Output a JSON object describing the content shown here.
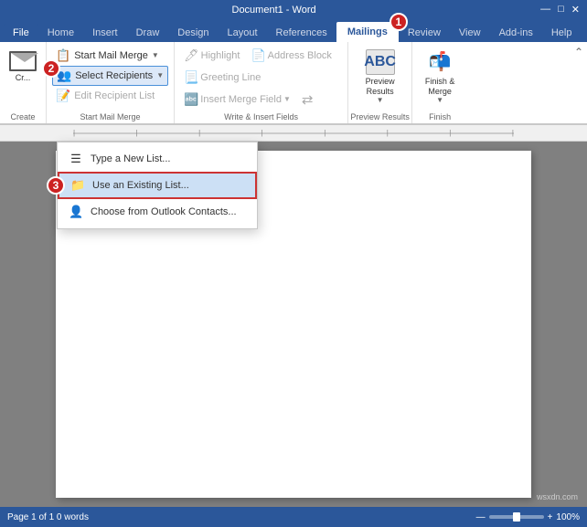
{
  "titleBar": {
    "text": "Document1 - Word"
  },
  "ribbonTabs": {
    "tabs": [
      {
        "label": "File",
        "active": false
      },
      {
        "label": "Home",
        "active": false
      },
      {
        "label": "Insert",
        "active": false
      },
      {
        "label": "Draw",
        "active": false
      },
      {
        "label": "Design",
        "active": false
      },
      {
        "label": "Layout",
        "active": false
      },
      {
        "label": "References",
        "active": false
      },
      {
        "label": "Mailings",
        "active": true
      },
      {
        "label": "Review",
        "active": false
      },
      {
        "label": "View",
        "active": false
      },
      {
        "label": "Add-ins",
        "active": false
      },
      {
        "label": "Help",
        "active": false
      }
    ]
  },
  "ribbon": {
    "groups": {
      "create": {
        "label": "Create",
        "buttons": [
          {
            "label": "Cr..."
          }
        ]
      },
      "startMailMerge": {
        "label": "Start Mail Merge",
        "startBtn": "Start Mail Merge",
        "selectRecipientsBtn": "Select Recipients",
        "editRecipientsBtn": "Edit Recipient List"
      },
      "writeInsertFields": {
        "label": "Write & Insert Fields",
        "highlightBtn": "Highlight",
        "addressBlockBtn": "Address Block",
        "greetingLineBtn": "Greeting Line",
        "insertMergeFieldBtn": "Insert Merge Field",
        "matchFieldsBtn": "Match Fields"
      },
      "previewResults": {
        "label": "Preview Results",
        "btn": "Preview\nResults"
      },
      "finish": {
        "label": "Finish",
        "btn": "Finish &\nMerge"
      }
    }
  },
  "dropdownMenu": {
    "items": [
      {
        "icon": "☰",
        "label": "Type a New List...",
        "highlighted": false
      },
      {
        "icon": "📁",
        "label": "Use an Existing List...",
        "highlighted": true
      },
      {
        "icon": "👤",
        "label": "Choose from Outlook Contacts...",
        "highlighted": false
      }
    ]
  },
  "steps": [
    {
      "number": "1",
      "description": "Mailings tab circle"
    },
    {
      "number": "2",
      "description": "Select Recipients circle"
    },
    {
      "number": "3",
      "description": "Use an Existing List circle"
    }
  ],
  "statusBar": {
    "left": "Page 1 of 1   0 words",
    "right": "wsxdn.com"
  }
}
